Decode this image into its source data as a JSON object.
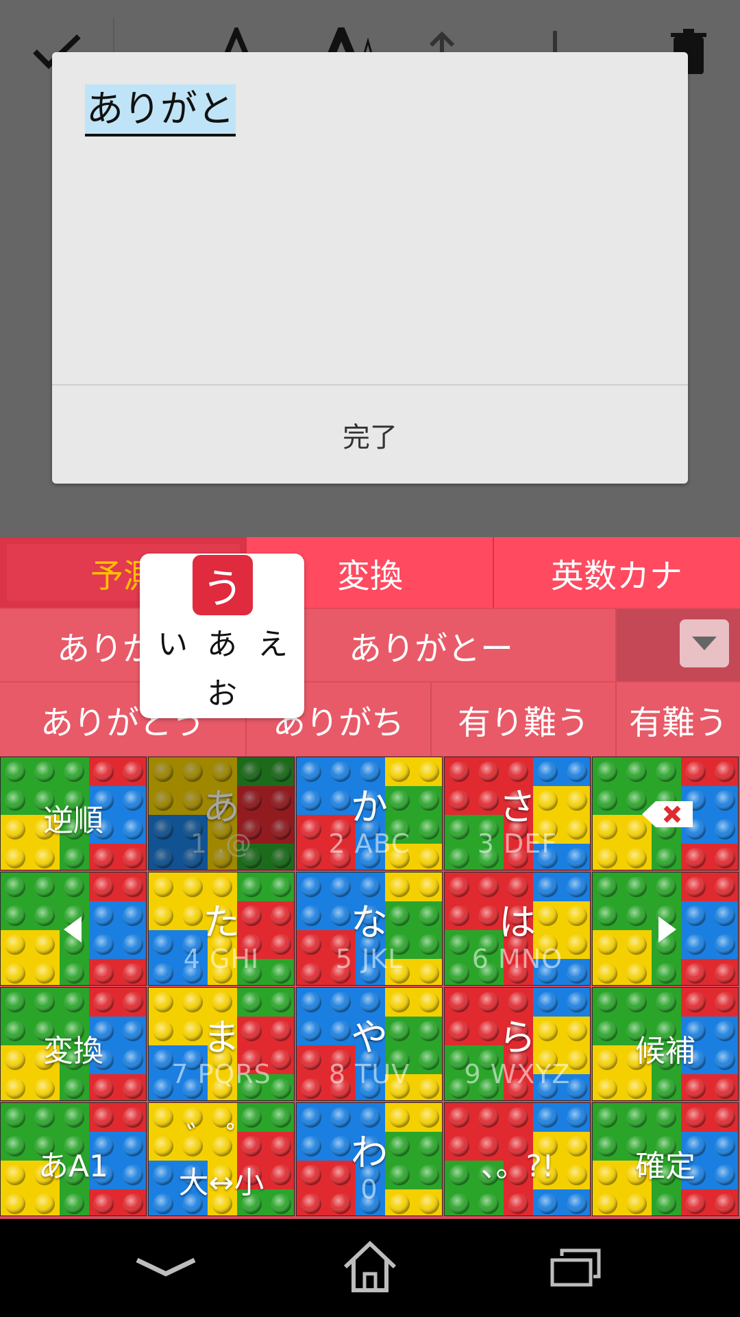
{
  "toolbar": {
    "icons": [
      "check-icon",
      "font-smaller-icon",
      "font-larger-icon",
      "move-up-icon",
      "move-down-icon",
      "trash-icon"
    ]
  },
  "dialog": {
    "text": "ありがと",
    "done_label": "完了"
  },
  "keyboard": {
    "modes": [
      "予測",
      "変換",
      "英数カナ"
    ],
    "candidates_row1": [
      "ありがと",
      "ありがとー"
    ],
    "candidates_row2": [
      "ありがとう",
      "ありがち",
      "有り難う",
      "有難う"
    ],
    "flick": {
      "center": "う",
      "left": "い",
      "middle": "あ",
      "right": "え",
      "bottom": "お"
    },
    "keys": {
      "reverse": "逆順",
      "a": "あ",
      "a_sub": "1   .@",
      "ka": "か",
      "ka_sub": "2  ABC",
      "sa": "さ",
      "sa_sub": "3  DEF",
      "ta": "た",
      "ta_sub": "4  GHI",
      "na": "な",
      "na_sub": "5  JKL",
      "ha": "は",
      "ha_sub": "6  MNO",
      "henkan": "変換",
      "ma": "ま",
      "ma_sub": "7 PQRS",
      "ya": "や",
      "ya_sub": "8   TUV",
      "ra": "ら",
      "ra_sub": "9 WXYZ",
      "kouho": "候補",
      "mode_switch": "あA1",
      "dakuten_top": "゛ ゜",
      "dakuten_bottom": "大↔小",
      "wa": "わ",
      "wa_sub": "0",
      "punct": "、。?!",
      "kakutei": "確定"
    }
  },
  "navbar": {
    "icons": [
      "back-icon",
      "home-icon",
      "recent-apps-icon"
    ]
  },
  "colors": {
    "mode_bar": "#ff4a60",
    "active_mode_text": "#ffc000",
    "candidate_bar": "#e85a68",
    "lego_red": "#e02a30",
    "lego_green": "#2aa52a",
    "lego_blue": "#1a7fe0",
    "lego_yellow": "#f5d000"
  }
}
